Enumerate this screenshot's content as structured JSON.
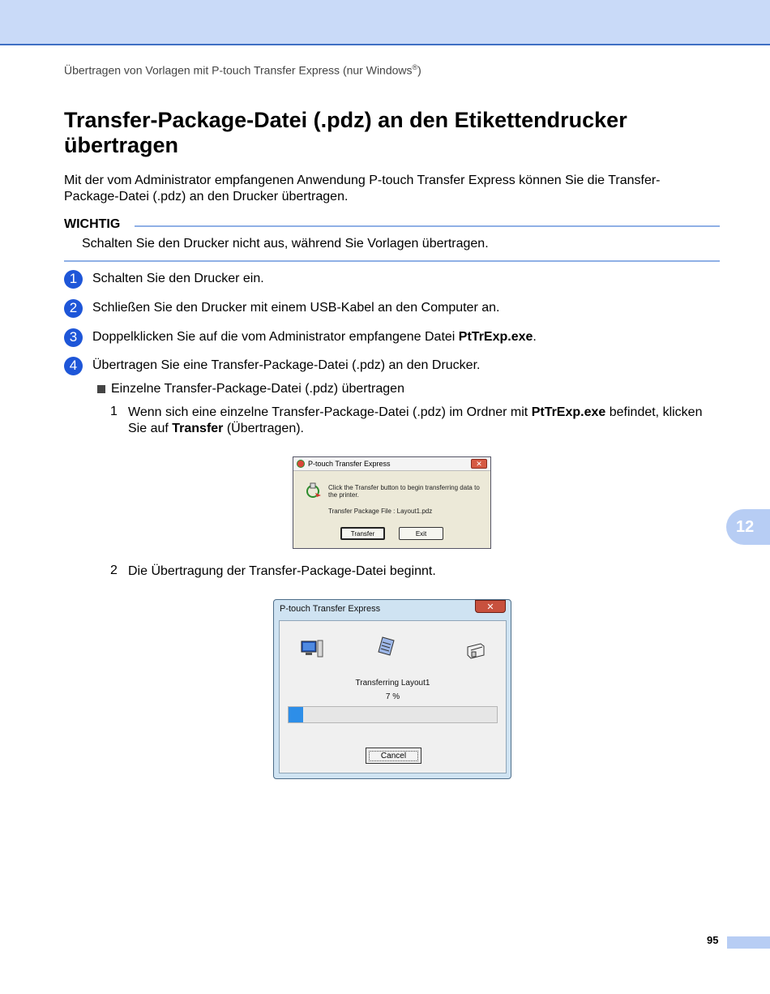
{
  "header": {
    "running_title": "Übertragen von Vorlagen mit P-touch Transfer Express (nur Windows",
    "registered_mark": "®",
    "running_title_close": ")"
  },
  "title": "Transfer-Package-Datei (.pdz) an den Etikettendrucker übertragen",
  "intro": "Mit der vom Administrator empfangenen Anwendung P-touch Transfer Express können Sie die Transfer-Package-Datei (.pdz) an den Drucker übertragen.",
  "important": {
    "label": "WICHTIG",
    "text": "Schalten Sie den Drucker nicht aus, während Sie Vorlagen übertragen."
  },
  "steps": [
    {
      "num": "1",
      "text": "Schalten Sie den Drucker ein."
    },
    {
      "num": "2",
      "text": "Schließen Sie den Drucker mit einem USB-Kabel an den Computer an."
    },
    {
      "num": "3",
      "text": "Doppelklicken Sie auf die vom Administrator empfangene Datei ",
      "bold": "PtTrExp.exe",
      "after": "."
    },
    {
      "num": "4",
      "text": "Übertragen Sie eine Transfer-Package-Datei (.pdz) an den Drucker."
    }
  ],
  "bullet": "Einzelne Transfer-Package-Datei (.pdz) übertragen",
  "substeps": [
    {
      "num": "1",
      "part1": "Wenn sich eine einzelne Transfer-Package-Datei (.pdz) im Ordner mit ",
      "bold1": "PtTrExp.exe",
      "part2": " befindet, klicken Sie auf ",
      "bold2": "Transfer",
      "part3": " (Übertragen)."
    },
    {
      "num": "2",
      "text": "Die Übertragung der Transfer-Package-Datei beginnt."
    }
  ],
  "dialog1": {
    "title": "P-touch Transfer Express",
    "message": "Click the Transfer button to begin transferring data to the printer.",
    "file": "Transfer Package File : Layout1.pdz",
    "transfer_button": "Transfer",
    "exit_button": "Exit",
    "close_glyph": "✕"
  },
  "dialog2": {
    "title": "P-touch Transfer Express",
    "status": "Transferring Layout1",
    "percent_label": "7 %",
    "progress_fraction": 0.07,
    "cancel_button": "Cancel",
    "close_glyph": "✕"
  },
  "chapter_tab": "12",
  "page_number": "95"
}
